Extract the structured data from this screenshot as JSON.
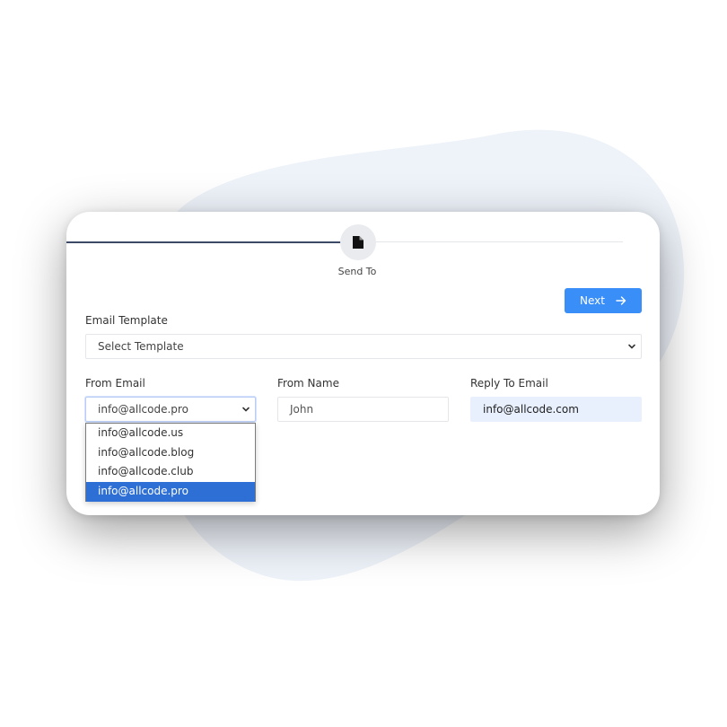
{
  "stepper": {
    "step_label": "Send To",
    "icon": "file-icon"
  },
  "form": {
    "next_label": "Next",
    "email_template": {
      "label": "Email Template",
      "value": "Select Template"
    },
    "from_email": {
      "label": "From Email",
      "value": "info@allcode.pro",
      "options": [
        "info@allcode.us",
        "info@allcode.blog",
        "info@allcode.club",
        "info@allcode.pro"
      ],
      "selected_index": 3
    },
    "from_name": {
      "label": "From Name",
      "value": "John"
    },
    "reply_to": {
      "label": "Reply To Email",
      "value": "info@allcode.com"
    }
  },
  "colors": {
    "accent": "#3a8ef7",
    "selected_option": "#2e6fd6",
    "autofill": "#e8f0fe",
    "blob": "#eef3fa"
  }
}
